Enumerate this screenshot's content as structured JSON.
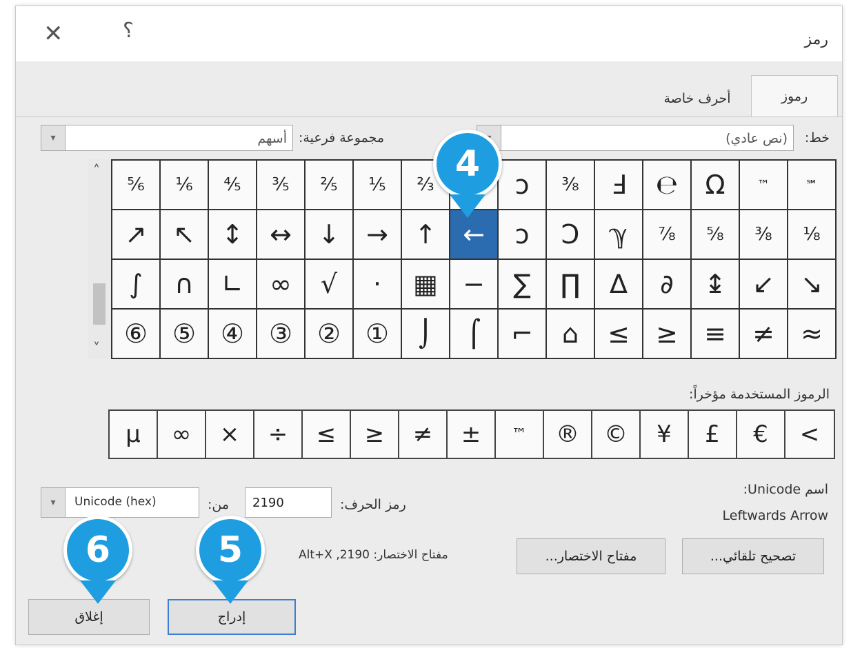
{
  "window": {
    "title": "رمز",
    "help_glyph": "؟",
    "close_glyph": "✕"
  },
  "tabs": [
    {
      "label": "رموز",
      "active": true
    },
    {
      "label": "أحرف خاصة",
      "active": false
    }
  ],
  "font": {
    "label": "خط:",
    "value": "(نص عادي)"
  },
  "subset": {
    "label": "مجموعة فرعية:",
    "value": "أسهم"
  },
  "grid": [
    [
      "⅚",
      "⅙",
      "⅘",
      "⅗",
      "⅖",
      "⅕",
      "⅔",
      "⅓",
      "ↄ",
      "⅜",
      "Ⅎ",
      "℮",
      "Ω",
      "™",
      "℠"
    ],
    [
      "↗",
      "↖",
      "↕",
      "↔",
      "↓",
      "→",
      "↑",
      "←",
      "ↄ",
      "Ↄ",
      "ℽ",
      "⅞",
      "⅝",
      "⅜",
      "⅛"
    ],
    [
      "∫",
      "∩",
      "∟",
      "∞",
      "√",
      "·",
      "▦",
      "−",
      "∑",
      "∏",
      "∆",
      "∂",
      "↨",
      "↙",
      "↘"
    ],
    [
      "⑥",
      "⑤",
      "④",
      "③",
      "②",
      "①",
      "⌡",
      "⌠",
      "⌐",
      "⌂",
      "≤",
      "≥",
      "≡",
      "≠",
      "≈"
    ]
  ],
  "selected_symbol": "←",
  "recent": {
    "label": "الرموز المستخدمة مؤخراً:",
    "symbols": [
      "µ",
      "∞",
      "×",
      "÷",
      "≤",
      "≥",
      "≠",
      "±",
      "™",
      "®",
      "©",
      "¥",
      "£",
      "€",
      "<"
    ]
  },
  "unicode": {
    "name_label": "اسم Unicode:",
    "name_value": "Leftwards Arrow"
  },
  "char_code": {
    "label": "رمز الحرف:",
    "value": "2190"
  },
  "from": {
    "label": "من:",
    "value": "Unicode (hex)"
  },
  "shortcut": {
    "label": "مفتاح الاختصار: 2190, Alt+X"
  },
  "buttons": {
    "autocorrect": "تصحيح تلقائي...",
    "shortcut_key": "مفتاح الاختصار...",
    "insert": "إدراج",
    "close": "إغلاق"
  },
  "callouts": [
    "4",
    "5",
    "6"
  ],
  "colors": {
    "callout": "#1e9ee0",
    "selection": "#2b6cb0"
  }
}
